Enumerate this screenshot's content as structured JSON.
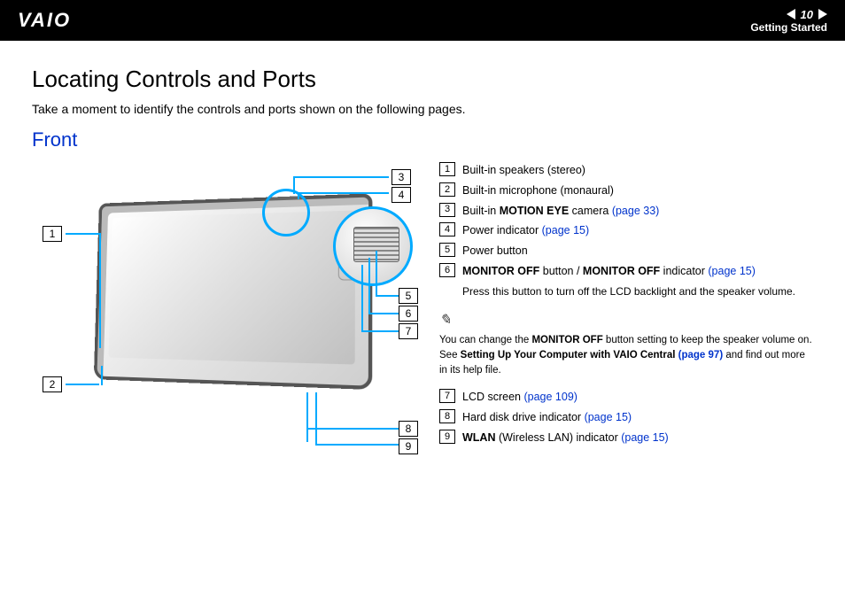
{
  "header": {
    "logo_text": "VAIO",
    "page_number": "10",
    "section": "Getting Started"
  },
  "title": "Locating Controls and Ports",
  "intro": "Take a moment to identify the controls and ports shown on the following pages.",
  "subtitle": "Front",
  "diagram": {
    "callouts": [
      "1",
      "2",
      "3",
      "4",
      "5",
      "6",
      "7",
      "8",
      "9"
    ]
  },
  "legend": [
    {
      "n": "1",
      "text": "Built-in speakers (stereo)"
    },
    {
      "n": "2",
      "text": "Built-in microphone (monaural)"
    },
    {
      "n": "3",
      "text_pre": "Built-in ",
      "bold": "MOTION EYE",
      "text_post": " camera ",
      "link": "(page 33)"
    },
    {
      "n": "4",
      "text": "Power indicator ",
      "link": "(page 15)"
    },
    {
      "n": "5",
      "text": "Power button"
    },
    {
      "n": "6",
      "bold": "MONITOR OFF",
      "text_mid": " button / ",
      "bold2": "MONITOR OFF",
      "text_post": " indicator ",
      "link": "(page 15)",
      "sub": "Press this button to turn off the LCD backlight and the speaker volume."
    }
  ],
  "tip": {
    "pre": "You can change the ",
    "bold1": "MONITOR OFF",
    "mid1": " button setting to keep the speaker volume on. See ",
    "bold2": "Setting Up Your Computer with VAIO Central ",
    "link": "(page 97)",
    "post": " and find out more in its help file."
  },
  "legend2": [
    {
      "n": "7",
      "text": "LCD screen ",
      "link": "(page 109)"
    },
    {
      "n": "8",
      "text": "Hard disk drive indicator ",
      "link": "(page 15)"
    },
    {
      "n": "9",
      "bold": "WLAN",
      "text_post": " (Wireless LAN) indicator ",
      "link": "(page 15)"
    }
  ]
}
